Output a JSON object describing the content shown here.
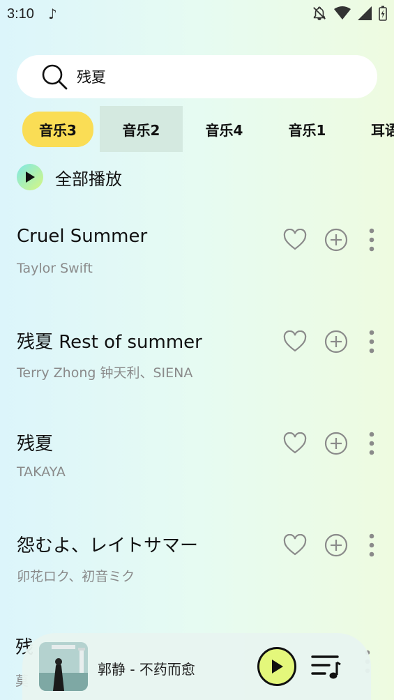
{
  "status_bar": {
    "time": "3:10",
    "icons": [
      "music-note-icon",
      "bell-off-icon",
      "wifi-icon",
      "signal-icon",
      "battery-icon"
    ]
  },
  "search": {
    "value": "残夏",
    "placeholder": ""
  },
  "tabs": [
    {
      "label": "音乐3",
      "state": "selected"
    },
    {
      "label": "音乐2",
      "state": "pressed"
    },
    {
      "label": "音乐4",
      "state": "normal"
    },
    {
      "label": "音乐1",
      "state": "normal"
    },
    {
      "label": "耳语",
      "state": "normal"
    }
  ],
  "play_all": {
    "label": "全部播放"
  },
  "songs": [
    {
      "title": "Cruel Summer",
      "artist": "Taylor Swift"
    },
    {
      "title": "残夏 Rest of summer",
      "artist": "Terry Zhong 钟天利、SIENA"
    },
    {
      "title": "残夏",
      "artist": "TAKAYA"
    },
    {
      "title": "怨むよ、レイトサマー",
      "artist": "卯花ロク、初音ミク"
    }
  ],
  "partial_song": {
    "title": "残",
    "artist": "莫"
  },
  "mini_player": {
    "track": "郭静 - 不药而愈"
  },
  "colors": {
    "accent_yellow": "#fadd55",
    "play_button": "#e4f77b",
    "pressed_tab": "#d4e9e0",
    "secondary_text": "#8a8a8a"
  }
}
